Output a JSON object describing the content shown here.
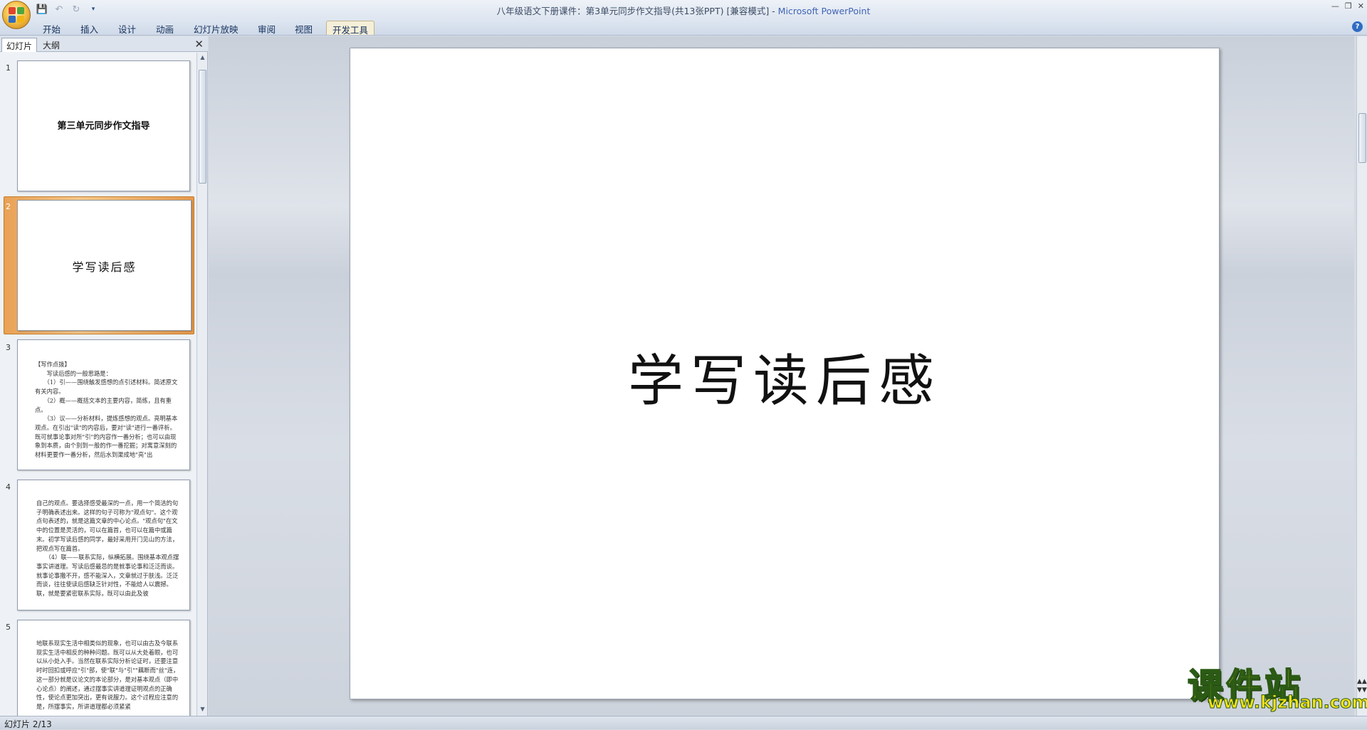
{
  "window": {
    "title_doc": "八年级语文下册课件：第3单元同步作文指导(共13张PPT) [兼容模式] - ",
    "title_app": "Microsoft PowerPoint"
  },
  "ribbon": {
    "tabs": [
      "开始",
      "插入",
      "设计",
      "动画",
      "幻灯片放映",
      "审阅",
      "视图",
      "开发工具"
    ],
    "active_tab": "开发工具"
  },
  "left_pane": {
    "tabs": [
      "幻灯片",
      "大纲"
    ],
    "active_tab": "幻灯片",
    "slides": [
      {
        "num": "1",
        "title": "第三单元同步作文指导"
      },
      {
        "num": "2",
        "title": "学写读后感"
      },
      {
        "num": "3",
        "text": "【写作点拨】\n　　写读后感的一般思路是：\n　　（1）引——围绕触发感想的点引述材料。简述原文有关内容。\n　　（2）概——概括文本的主要内容，简练，且有重点。\n　　（3）议——分析材料，提炼感想的观点。亮明基本观点。在引出\"读\"的内容后，要对\"读\"进行一番评析。既可就事论事对所\"引\"的内容作一番分析；也可以由现象到本质，由个别到一般的作一番挖掘；对寓意深刻的材料更要作一番分析，然后水到渠成地\"亮\"出"
      },
      {
        "num": "4",
        "text": "自己的观点。要选择感受最深的一点，用一个简洁的句子明确表述出来。这样的句子可称为\"观点句\"。这个观点句表述的，就是这篇文章的中心论点。\"观点句\"在文中的位置是灵活的，可以在篇首，也可以在篇中或篇末。初学写读后感的同学，最好采用开门见山的方法，把观点写在篇首。\n　　（4）联——联系实际，纵横拓展。围绕基本观点摆事实讲道理。写读后感最忌的是就事论事和泛泛而谈。就事论事撒不开，感不能深入，文章就过于肤浅。泛泛而谈，往往使读后感缺乏针对性，不能给人以震撼。联，就是要紧密联系实际，既可以由此及彼"
      },
      {
        "num": "5",
        "text": "地联系现实生活中相类似的现象，也可以由古及今联系现实生活中相反的种种问题。既可以从大处着眼，也可以从小处入手。当然在联系实际分析论证时，还要注意时时回扣或呼应\"引\"部，使\"联\"与\"引\"\"藕断而\"丝\"连，这一部分就是议论文的本论部分，是对基本观点（即中心论点）的阐述，通过摆事实讲道理证明观点的正确性，使论点更加突出，更有说服力。这个过程应注意的是，所摆事实，所讲道理都必须紧紧"
      }
    ]
  },
  "current_slide": {
    "title": "学写读后感"
  },
  "status": {
    "slide_indicator": "幻灯片 2/13"
  },
  "watermark": {
    "cn": "课件站",
    "url": "www.kjzhan.com"
  }
}
